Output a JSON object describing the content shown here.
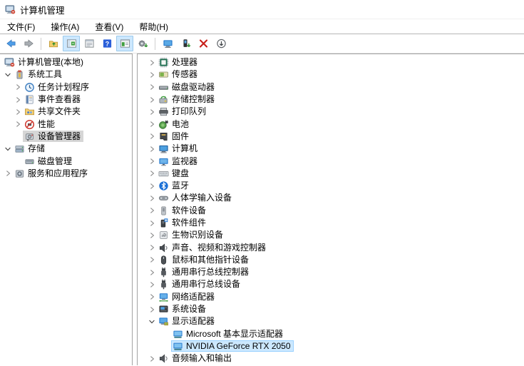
{
  "window": {
    "title": "计算机管理",
    "icon": "computer-management-icon"
  },
  "menu_bar": {
    "items": [
      {
        "name": "file",
        "label": "文件(F)"
      },
      {
        "name": "action",
        "label": "操作(A)"
      },
      {
        "name": "view",
        "label": "查看(V)"
      },
      {
        "name": "help",
        "label": "帮助(H)"
      }
    ]
  },
  "toolbar": {
    "buttons": [
      {
        "name": "back-button",
        "icon": "arrow-left-icon"
      },
      {
        "name": "forward-button",
        "icon": "arrow-right-icon"
      },
      {
        "type": "separator"
      },
      {
        "name": "up-level-button",
        "icon": "folder-up-icon"
      },
      {
        "name": "show-console-tree-button",
        "icon": "console-tree-icon",
        "active": true
      },
      {
        "name": "properties-button",
        "icon": "properties-icon"
      },
      {
        "name": "help-button",
        "icon": "help-icon"
      },
      {
        "name": "show-action-pane-button",
        "icon": "action-pane-icon",
        "active": true
      },
      {
        "name": "update-driver-button",
        "icon": "gear-update-icon"
      },
      {
        "type": "separator"
      },
      {
        "name": "scan-hardware-button",
        "icon": "scan-hardware-icon"
      },
      {
        "name": "install-driver-button",
        "icon": "driver-install-icon"
      },
      {
        "name": "uninstall-device-button",
        "icon": "uninstall-icon"
      },
      {
        "name": "disable-device-button",
        "icon": "disable-icon"
      }
    ]
  },
  "sidebar": {
    "items": [
      {
        "name": "computer-management-root",
        "label": "计算机管理(本地)",
        "icon": "computer-management-icon",
        "level": 0,
        "chevron": "root"
      },
      {
        "name": "system-tools",
        "label": "系统工具",
        "icon": "system-tools-icon",
        "level": 0,
        "chevron": "expanded"
      },
      {
        "name": "task-scheduler",
        "label": "任务计划程序",
        "icon": "task-scheduler-icon",
        "level": 1,
        "chevron": "collapsed"
      },
      {
        "name": "event-viewer",
        "label": "事件查看器",
        "icon": "event-viewer-icon",
        "level": 1,
        "chevron": "collapsed"
      },
      {
        "name": "shared-folders",
        "label": "共享文件夹",
        "icon": "shared-folders-icon",
        "level": 1,
        "chevron": "collapsed"
      },
      {
        "name": "performance",
        "label": "性能",
        "icon": "performance-icon",
        "level": 1,
        "chevron": "collapsed"
      },
      {
        "name": "device-manager",
        "label": "设备管理器",
        "icon": "device-manager-icon",
        "level": 1,
        "chevron": "none",
        "selected": "inactive"
      },
      {
        "name": "storage",
        "label": "存储",
        "icon": "storage-icon",
        "level": 0,
        "chevron": "expanded"
      },
      {
        "name": "disk-management",
        "label": "磁盘管理",
        "icon": "disk-management-icon",
        "level": 1,
        "chevron": "none"
      },
      {
        "name": "services-and-apps",
        "label": "服务和应用程序",
        "icon": "services-icon",
        "level": 0,
        "chevron": "collapsed"
      }
    ]
  },
  "device_list": {
    "items": [
      {
        "name": "processors",
        "label": "处理器",
        "icon": "processor-icon",
        "level": 0,
        "chevron": "collapsed"
      },
      {
        "name": "sensors",
        "label": "传感器",
        "icon": "sensor-icon",
        "level": 0,
        "chevron": "collapsed"
      },
      {
        "name": "disk-drives",
        "label": "磁盘驱动器",
        "icon": "disk-drive-icon",
        "level": 0,
        "chevron": "collapsed"
      },
      {
        "name": "storage-controllers",
        "label": "存储控制器",
        "icon": "storage-controller-icon",
        "level": 0,
        "chevron": "collapsed"
      },
      {
        "name": "print-queues",
        "label": "打印队列",
        "icon": "printer-icon",
        "level": 0,
        "chevron": "collapsed"
      },
      {
        "name": "batteries",
        "label": "电池",
        "icon": "battery-icon",
        "level": 0,
        "chevron": "collapsed"
      },
      {
        "name": "firmware",
        "label": "固件",
        "icon": "firmware-icon",
        "level": 0,
        "chevron": "collapsed"
      },
      {
        "name": "computer",
        "label": "计算机",
        "icon": "computer-icon",
        "level": 0,
        "chevron": "collapsed"
      },
      {
        "name": "monitors",
        "label": "监视器",
        "icon": "monitor-icon",
        "level": 0,
        "chevron": "collapsed"
      },
      {
        "name": "keyboards",
        "label": "键盘",
        "icon": "keyboard-icon",
        "level": 0,
        "chevron": "collapsed"
      },
      {
        "name": "bluetooth",
        "label": "蓝牙",
        "icon": "bluetooth-icon",
        "level": 0,
        "chevron": "collapsed"
      },
      {
        "name": "hid-devices",
        "label": "人体学输入设备",
        "icon": "hid-icon",
        "level": 0,
        "chevron": "collapsed"
      },
      {
        "name": "software-devices",
        "label": "软件设备",
        "icon": "software-device-icon",
        "level": 0,
        "chevron": "collapsed"
      },
      {
        "name": "software-components",
        "label": "软件组件",
        "icon": "software-component-icon",
        "level": 0,
        "chevron": "collapsed"
      },
      {
        "name": "biometric-devices",
        "label": "生物识别设备",
        "icon": "biometric-icon",
        "level": 0,
        "chevron": "collapsed"
      },
      {
        "name": "sound-video-game",
        "label": "声音、视频和游戏控制器",
        "icon": "sound-icon",
        "level": 0,
        "chevron": "collapsed"
      },
      {
        "name": "mice-pointing",
        "label": "鼠标和其他指针设备",
        "icon": "mouse-icon",
        "level": 0,
        "chevron": "collapsed"
      },
      {
        "name": "usb-controllers",
        "label": "通用串行总线控制器",
        "icon": "usb-icon",
        "level": 0,
        "chevron": "collapsed"
      },
      {
        "name": "usb-devices",
        "label": "通用串行总线设备",
        "icon": "usb-icon",
        "level": 0,
        "chevron": "collapsed"
      },
      {
        "name": "network-adapters",
        "label": "网络适配器",
        "icon": "network-adapter-icon",
        "level": 0,
        "chevron": "collapsed"
      },
      {
        "name": "system-devices",
        "label": "系统设备",
        "icon": "system-device-icon",
        "level": 0,
        "chevron": "collapsed"
      },
      {
        "name": "display-adapters",
        "label": "显示适配器",
        "icon": "display-adapter-icon",
        "level": 0,
        "chevron": "expanded"
      },
      {
        "name": "microsoft-basic-display-adapter",
        "label": "Microsoft 基本显示适配器",
        "icon": "gpu-icon",
        "level": 1,
        "chevron": "none"
      },
      {
        "name": "nvidia-geforce-rtx-2050",
        "label": "NVIDIA GeForce RTX 2050",
        "icon": "gpu-icon",
        "level": 1,
        "chevron": "none",
        "selected": "active"
      },
      {
        "name": "audio-inputs-outputs",
        "label": "音频输入和输出",
        "icon": "audio-io-icon",
        "level": 0,
        "chevron": "collapsed"
      }
    ]
  },
  "colors": {
    "selection_active": "#cce8ff",
    "selection_active_border": "#99d1ff",
    "selection_inactive": "#d6d6d6",
    "toolbar_toggle_bg": "#cde8ff",
    "help_blue": "#2b5fd9",
    "uninstall_red": "#c8201a",
    "driver_green": "#2f8f2f"
  }
}
